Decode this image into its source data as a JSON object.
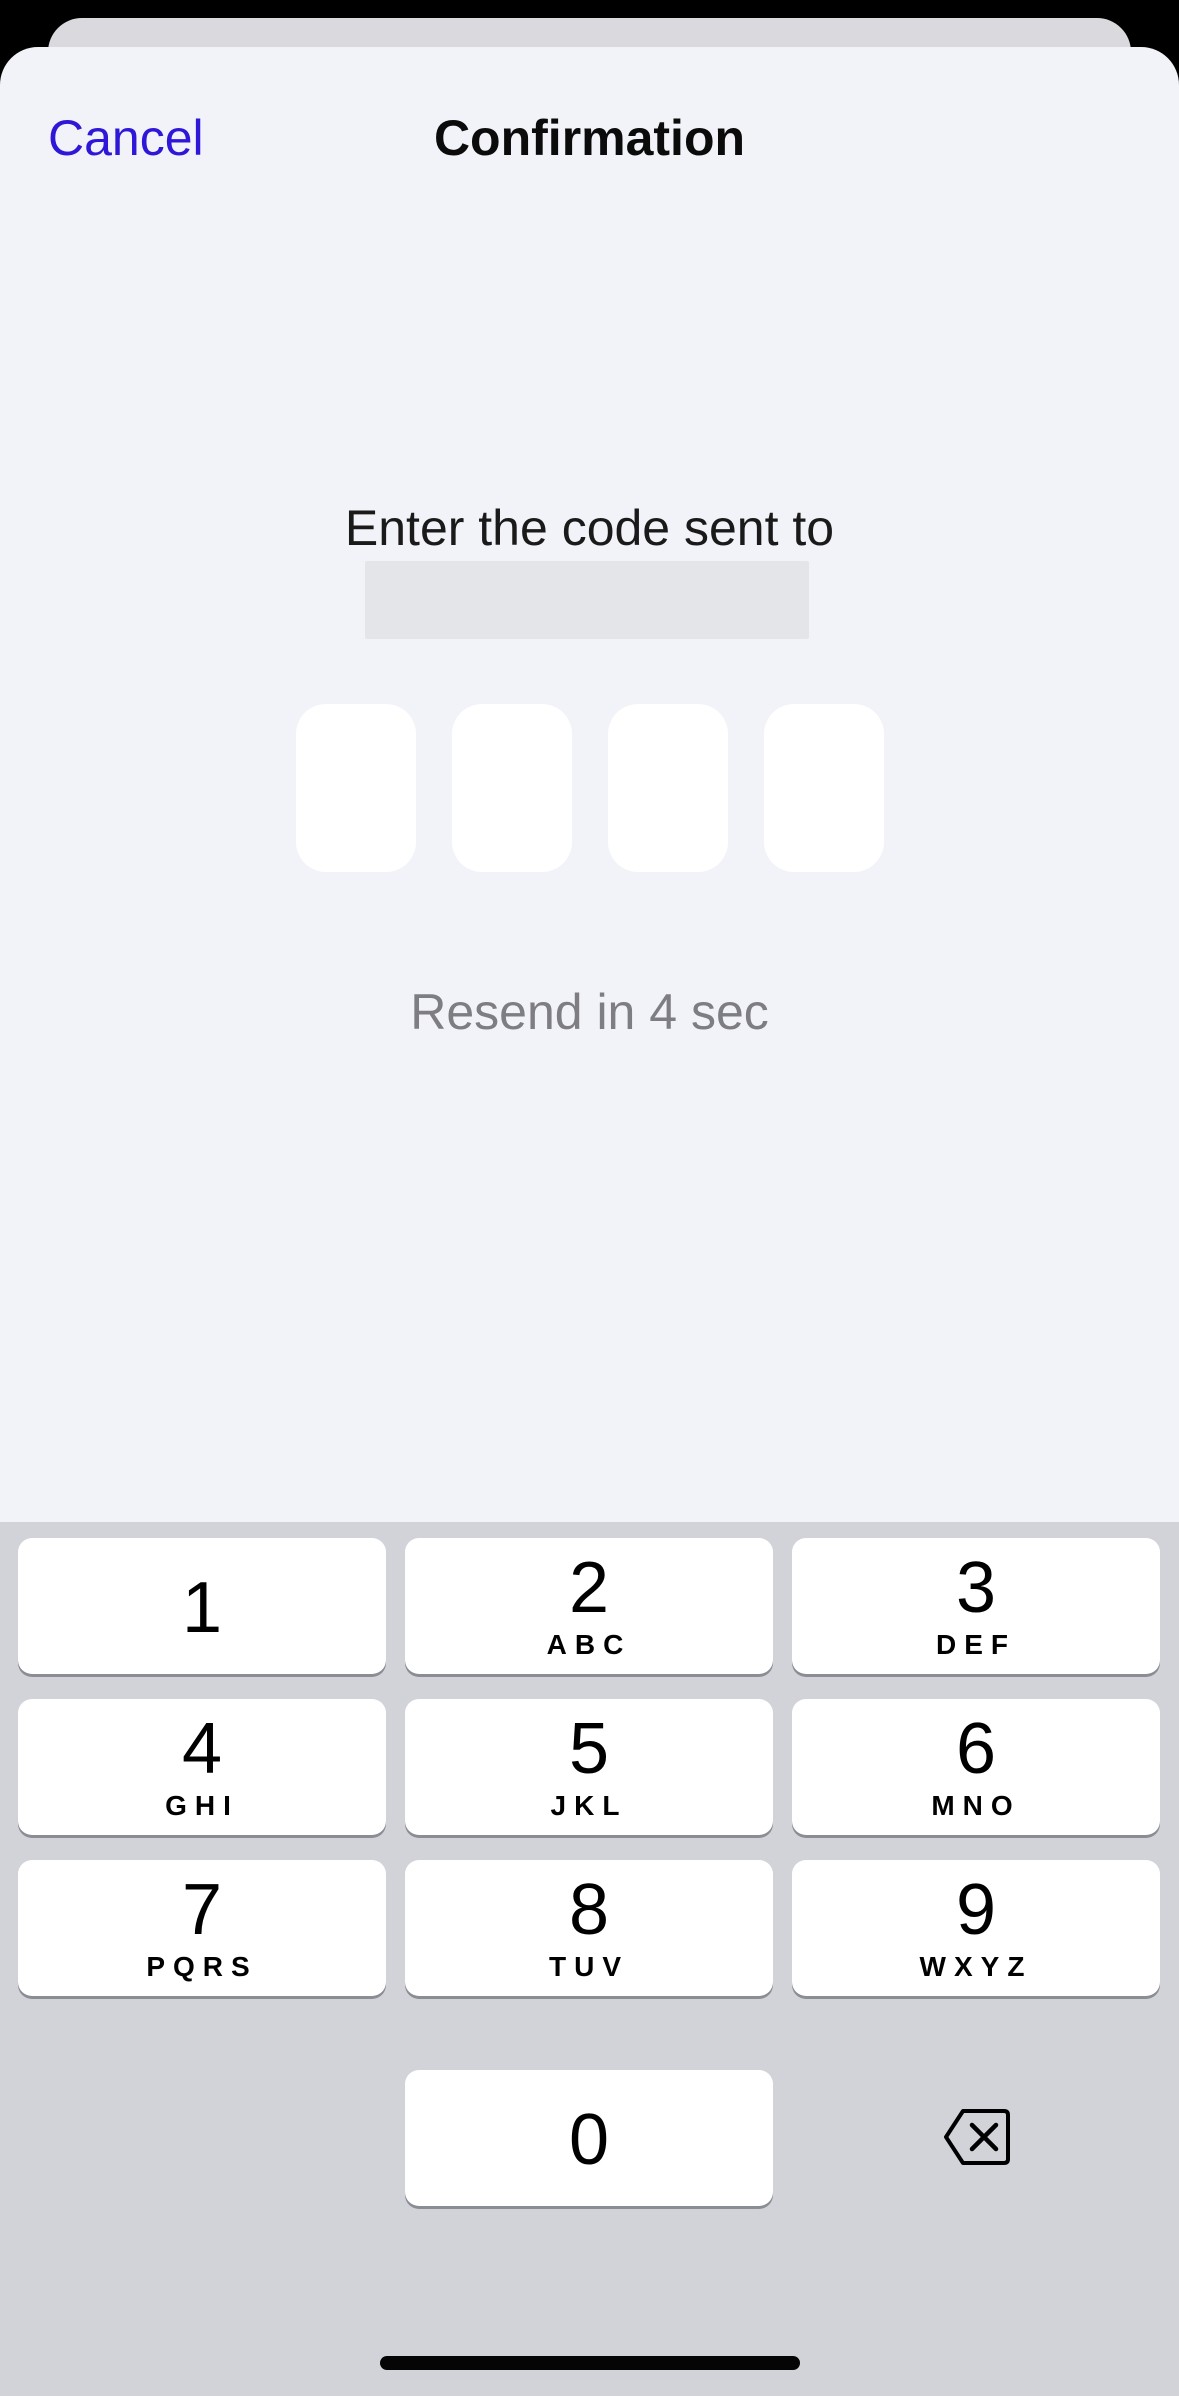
{
  "header": {
    "cancel_label": "Cancel",
    "title": "Confirmation"
  },
  "prompt": {
    "text": "Enter the code sent to"
  },
  "code": {
    "digits": [
      "",
      "",
      "",
      ""
    ]
  },
  "resend": {
    "text": "Resend in 4 sec"
  },
  "keyboard": {
    "keys": [
      {
        "digit": "1",
        "letters": ""
      },
      {
        "digit": "2",
        "letters": "ABC"
      },
      {
        "digit": "3",
        "letters": "DEF"
      },
      {
        "digit": "4",
        "letters": "GHI"
      },
      {
        "digit": "5",
        "letters": "JKL"
      },
      {
        "digit": "6",
        "letters": "MNO"
      },
      {
        "digit": "7",
        "letters": "PQRS"
      },
      {
        "digit": "8",
        "letters": "TUV"
      },
      {
        "digit": "9",
        "letters": "WXYZ"
      },
      {
        "digit": "0",
        "letters": ""
      }
    ],
    "delete_icon": "delete-backspace-icon"
  },
  "colors": {
    "accent": "#2f17d8",
    "sheet_background": "#f2f3f8",
    "keyboard_background": "#d1d3d9",
    "secondary_text": "#7d7d82"
  }
}
